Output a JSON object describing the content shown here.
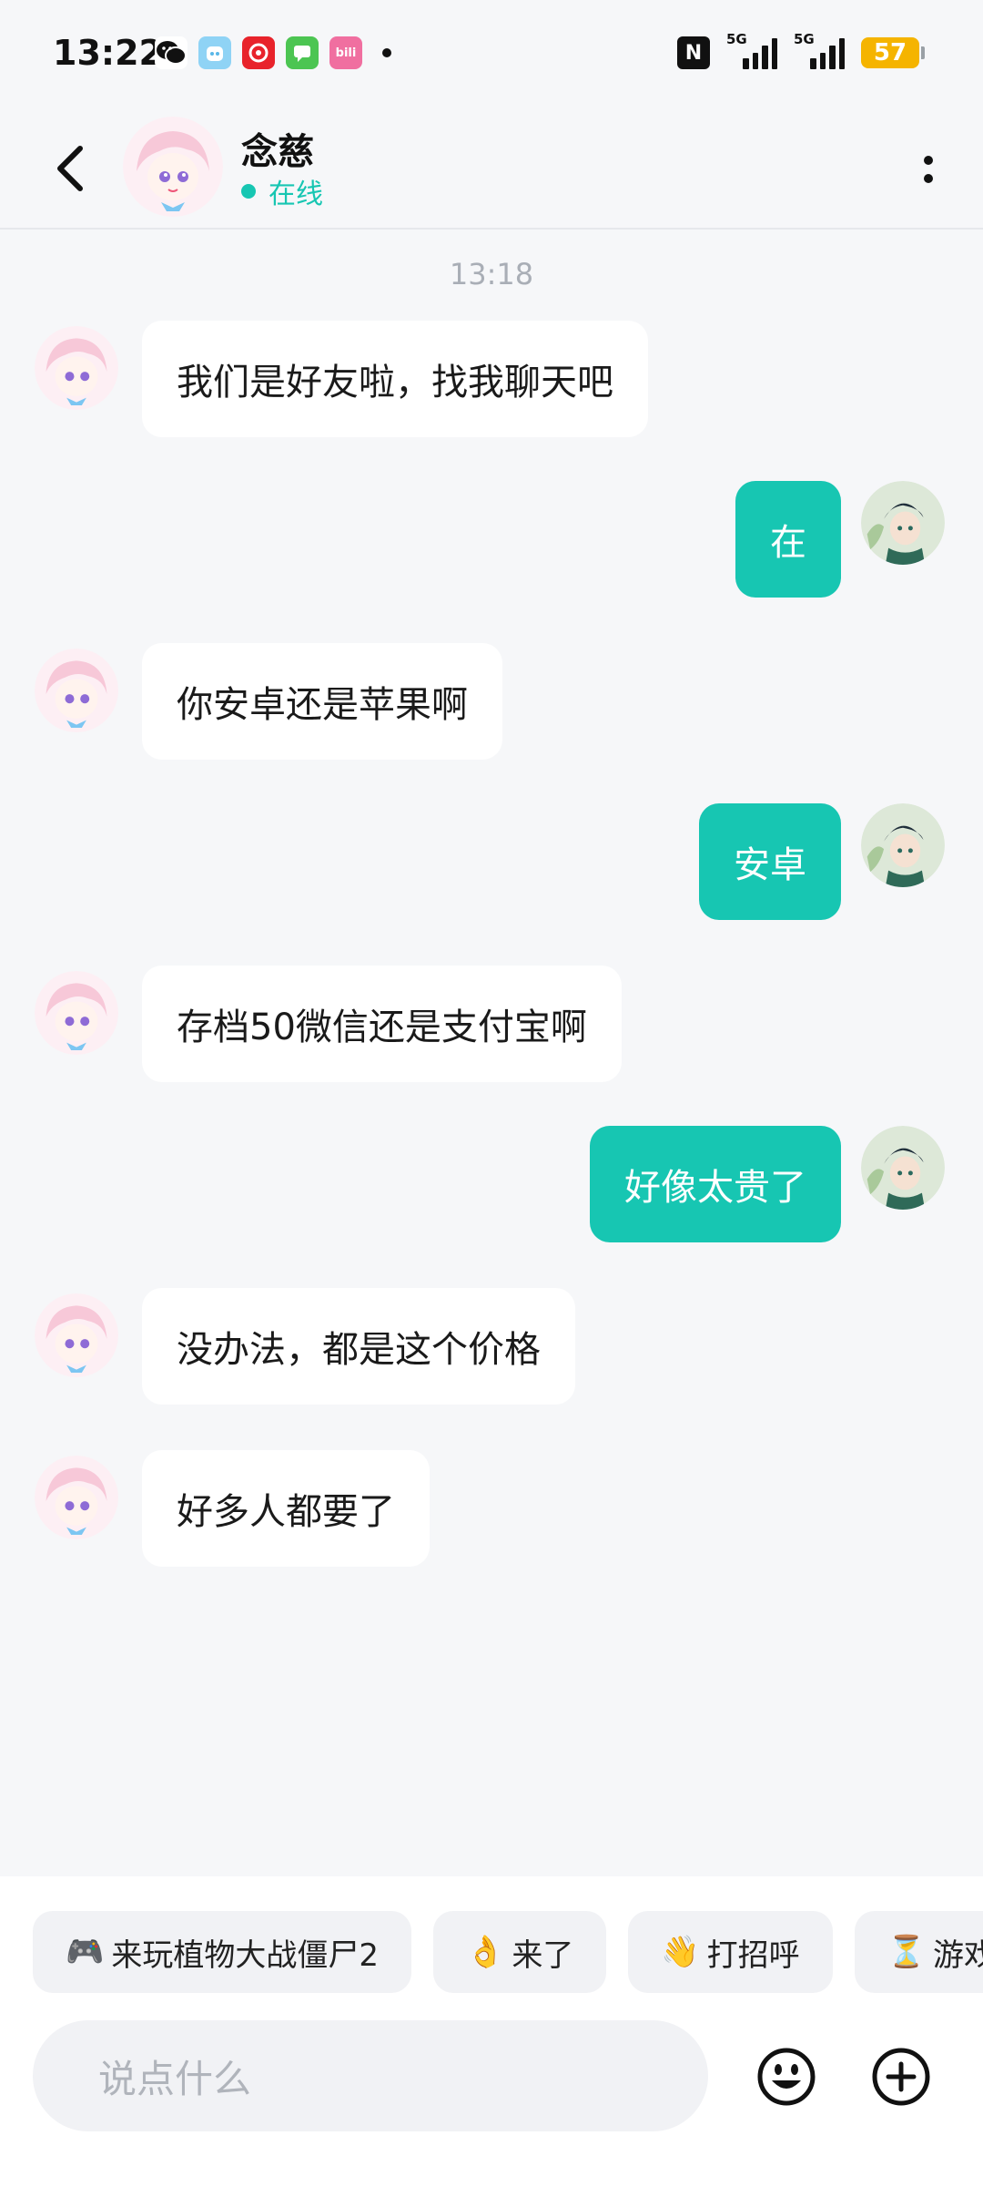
{
  "status_bar": {
    "time": "13:22",
    "apps": [
      "wechat-icon",
      "app-blue-icon",
      "app-red-icon",
      "messages-icon",
      "bilibili-icon"
    ],
    "nfc": "N",
    "signal1_label": "5G",
    "signal2_label": "5G",
    "battery": "57",
    "colors": {
      "battery": "#F5B400"
    }
  },
  "header": {
    "name": "念慈",
    "status": "在线",
    "status_color": "#17C6B2"
  },
  "chat": {
    "timestamp": "13:18",
    "messages": [
      {
        "side": "in",
        "text": "我们是好友啦，找我聊天吧"
      },
      {
        "side": "out",
        "text": "在"
      },
      {
        "side": "in",
        "text": "你安卓还是苹果啊"
      },
      {
        "side": "out",
        "text": "安卓"
      },
      {
        "side": "in",
        "text": "存档50微信还是支付宝啊"
      },
      {
        "side": "out",
        "text": "好像太贵了"
      },
      {
        "side": "in",
        "text": "没办法，都是这个价格"
      },
      {
        "side": "in",
        "text": "好多人都要了"
      }
    ]
  },
  "quick_replies": [
    {
      "emoji": "🎮",
      "label": "来玩植物大战僵尸2"
    },
    {
      "emoji": "👌",
      "label": "来了"
    },
    {
      "emoji": "👋",
      "label": "打招呼"
    },
    {
      "emoji": "⏳",
      "label": "游戏"
    }
  ],
  "input": {
    "placeholder": "说点什么"
  },
  "colors": {
    "accent": "#17C6B2",
    "background": "#F6F7F9"
  }
}
